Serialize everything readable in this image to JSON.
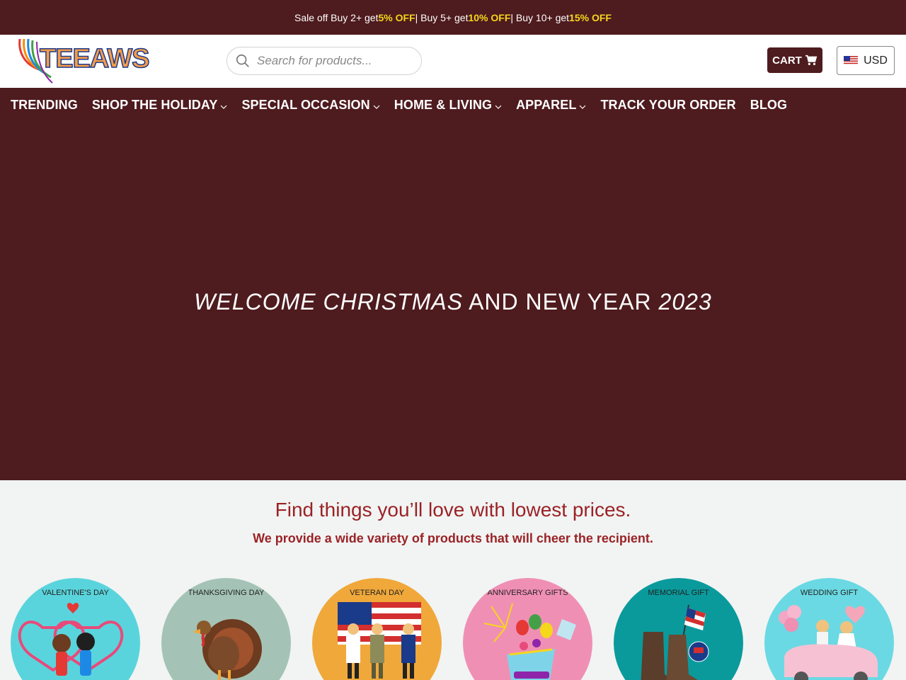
{
  "promo": {
    "part1": "Sale off Buy 2+ get ",
    "hl1": "5% OFF",
    "part2": " | Buy 5+ get ",
    "hl2": "10% OFF",
    "part3": " | Buy 10+ get ",
    "hl3": "15% OFF"
  },
  "header": {
    "logo_text": "TEEAWS",
    "search_placeholder": "Search for products...",
    "cart_label": "CART",
    "currency": "USD"
  },
  "nav": {
    "items": [
      {
        "label": "TRENDING",
        "dropdown": false
      },
      {
        "label": "SHOP THE HOLIDAY",
        "dropdown": true
      },
      {
        "label": "SPECIAL OCCASION",
        "dropdown": true
      },
      {
        "label": "HOME & LIVING",
        "dropdown": true
      },
      {
        "label": "APPAREL",
        "dropdown": true
      },
      {
        "label": "TRACK YOUR ORDER",
        "dropdown": false
      },
      {
        "label": "BLOG",
        "dropdown": false
      }
    ]
  },
  "hero": {
    "part1": "WELCOME CHRISTMAS",
    "part2": " AND NEW YEAR ",
    "part3": "2023"
  },
  "intro": {
    "heading": "Find things you’ll love with lowest prices.",
    "subheading": "We provide a wide variety of products that will cheer the recipient."
  },
  "categories": [
    {
      "label": "VALENTINE'S DAY",
      "bg": "#5ad4dc",
      "icon": "couple-heart-icon"
    },
    {
      "label": "THANKSGIVING DAY",
      "bg": "#a4c3b6",
      "icon": "turkey-icon"
    },
    {
      "label": "VETERAN DAY",
      "bg": "#f0a83a",
      "icon": "veterans-flag-icon"
    },
    {
      "label": "ANNIVERSARY GIFTS",
      "bg": "#f08fb4",
      "icon": "gift-box-icon"
    },
    {
      "label": "MEMORIAL GIFT",
      "bg": "#0a9a9c",
      "icon": "boots-flag-icon"
    },
    {
      "label": "WEDDING GIFT",
      "bg": "#6ad9e3",
      "icon": "wedding-car-icon"
    }
  ],
  "colors": {
    "brand": "#4e1b1e",
    "accent_text": "#9b2226",
    "promo_highlight": "#f5d71b"
  }
}
